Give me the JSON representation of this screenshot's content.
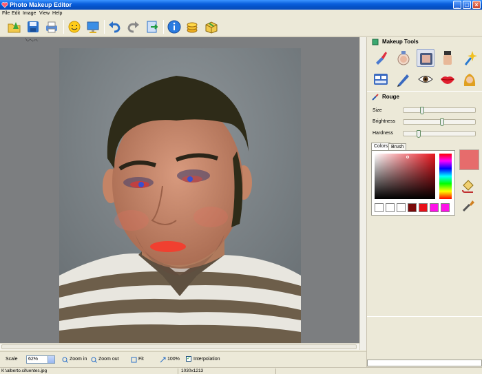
{
  "window": {
    "title": "Photo Makeup Editor",
    "minimize": "_",
    "maximize": "□",
    "close": "×"
  },
  "menu": [
    "File",
    "Edit",
    "Image",
    "View",
    "Help"
  ],
  "toolbar_icons": [
    "open-icon",
    "save-icon",
    "print-icon",
    "face-detect-icon",
    "monitor-icon",
    "undo-icon",
    "redo-icon",
    "export-icon",
    "info-icon",
    "coins-icon",
    "box-icon"
  ],
  "panel": {
    "makeup_tools_title": "Makeup Tools",
    "tools_row1": [
      "lipstick-icon",
      "powder-icon",
      "foundation-icon",
      "concealer-icon",
      "sparkle-icon"
    ],
    "tools_row2": [
      "eyeshadow-palette-icon",
      "pencil-icon",
      "eye-icon",
      "lips-icon",
      "hair-icon"
    ],
    "selected_tool": "foundation-icon",
    "rouge_title": "Rouge",
    "sliders": [
      {
        "label": "Size",
        "value": 0.25
      },
      {
        "label": "Brightness",
        "value": 0.55
      },
      {
        "label": "Hardness",
        "value": 0.2
      }
    ],
    "tabs": [
      "Colors",
      "Brush"
    ],
    "active_tab": "Colors",
    "swatches": [
      "#ffffff",
      "#ffffff",
      "#ffffff",
      "#7a0a0a",
      "#e8101a",
      "#ff10e8",
      "#ff10e8"
    ],
    "current_color": "#e66c6c"
  },
  "bottom": {
    "scale_label": "Scale",
    "scale_value": "62%",
    "zoom_in": "Zoom in",
    "zoom_out": "Zoom out",
    "fit": "Fit",
    "hundred": "100%",
    "interpolation": "Interpolation",
    "interpolation_checked": true
  },
  "status": {
    "path": "K:\\alberto.cifuentes.jpg",
    "dimensions": "1030x1213"
  }
}
